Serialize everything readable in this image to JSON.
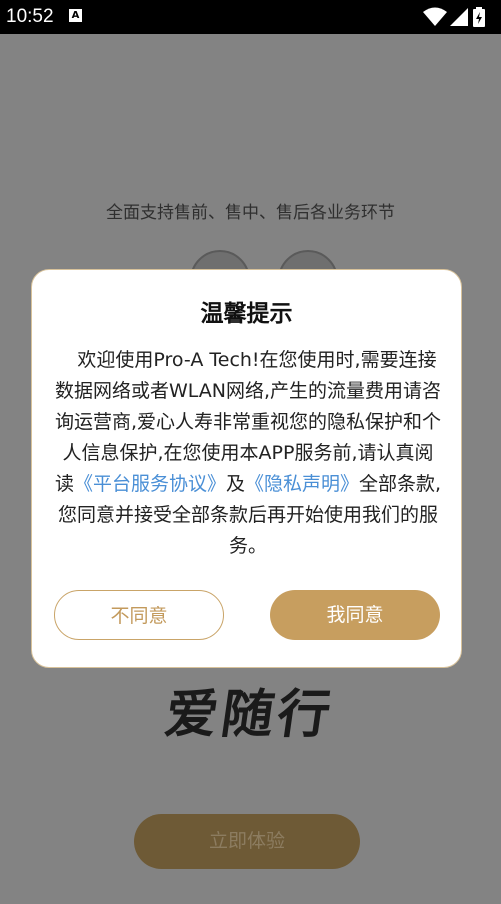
{
  "status_bar": {
    "time": "10:52",
    "notification_icon_letter": "A"
  },
  "background": {
    "subtitle": "全面支持售前、售中、售后各业务环节",
    "logo_text": "爱随行",
    "start_button_label": "立即体验"
  },
  "dialog": {
    "title": "温馨提示",
    "body_part1": "欢迎使用Pro-A Tech!在您使用时,需要连接数据网络或者WLAN网络,产生的流量费用请咨询运营商,爱心人寿非常重视您的隐私保护和个人信息保护,在您使用本APP服务前,请认真阅读",
    "link_service": "《平台服务协议》",
    "body_and": "及",
    "link_privacy": "《隐私声明》",
    "body_part2": "全部条款,您同意并接受全部条款后再开始使用我们的服务。",
    "disagree_label": "不同意",
    "agree_label": "我同意"
  },
  "colors": {
    "accent": "#c79e5f",
    "link": "#4a8fd6",
    "overlay": "#838383"
  }
}
